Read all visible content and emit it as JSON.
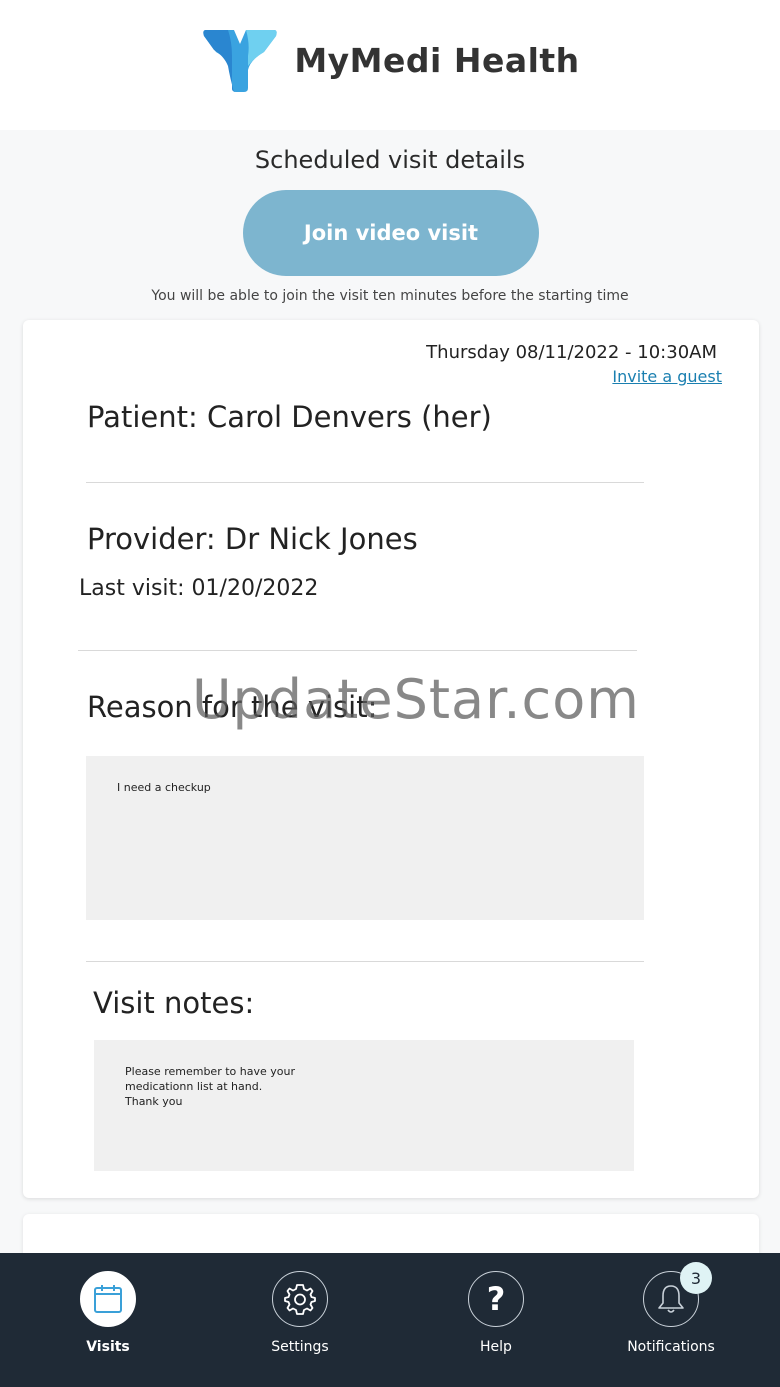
{
  "app": {
    "name": "MyMedi Health"
  },
  "page": {
    "title": "Scheduled visit details",
    "join_button": "Join video visit",
    "join_hint": "You will be able to join the visit ten minutes before the starting time"
  },
  "visit": {
    "datetime": "Thursday 08/11/2022 - 10:30AM",
    "invite_link": "Invite a guest",
    "patient": "Patient: Carol Denvers (her)",
    "provider": "Provider: Dr Nick Jones",
    "last_visit": "Last visit: 01/20/2022",
    "reason_heading": "Reason for the visit:",
    "reason_text": "I need a checkup",
    "notes_heading": "Visit notes:",
    "notes_text": "Please remember to have your\nmedicationn list at hand.\nThank you"
  },
  "watermark": "UpdateStar.com",
  "nav": {
    "items": [
      {
        "label": "Visits",
        "icon": "calendar-icon",
        "active": true
      },
      {
        "label": "Settings",
        "icon": "gear-icon",
        "active": false
      },
      {
        "label": "Help",
        "icon": "question-icon",
        "active": false
      },
      {
        "label": "Notifications",
        "icon": "bell-icon",
        "active": false
      }
    ],
    "notifications_badge": "3"
  },
  "colors": {
    "accent": "#7db5cf",
    "link": "#1a7fb0",
    "nav_bg": "#1f2a36",
    "logo_dark": "#1e7fd0",
    "logo_light": "#5cc7ec"
  }
}
